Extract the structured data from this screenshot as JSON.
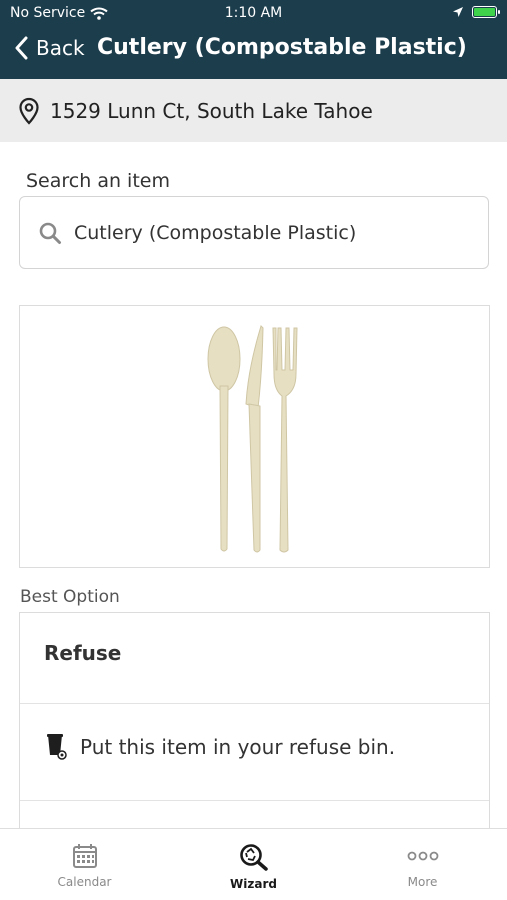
{
  "status_bar": {
    "carrier": "No Service",
    "time": "1:10 AM"
  },
  "nav": {
    "back_label": "Back",
    "title": "Cutlery (Compostable Plastic)"
  },
  "address": {
    "text": "1529 Lunn Ct, South Lake Tahoe"
  },
  "search": {
    "label": "Search an item",
    "value": "Cutlery (Compostable Plastic)"
  },
  "best_option": {
    "label": "Best Option",
    "title": "Refuse",
    "instruction": "Put this item in your refuse bin."
  },
  "tabs": [
    {
      "label": "Calendar",
      "icon": "calendar-icon",
      "active": false
    },
    {
      "label": "Wizard",
      "icon": "wizard-search-icon",
      "active": true
    },
    {
      "label": "More",
      "icon": "more-icon",
      "active": false
    }
  ],
  "colors": {
    "header": "#1c3d4c",
    "address_bg": "#ececec",
    "battery": "#3fd24b"
  }
}
